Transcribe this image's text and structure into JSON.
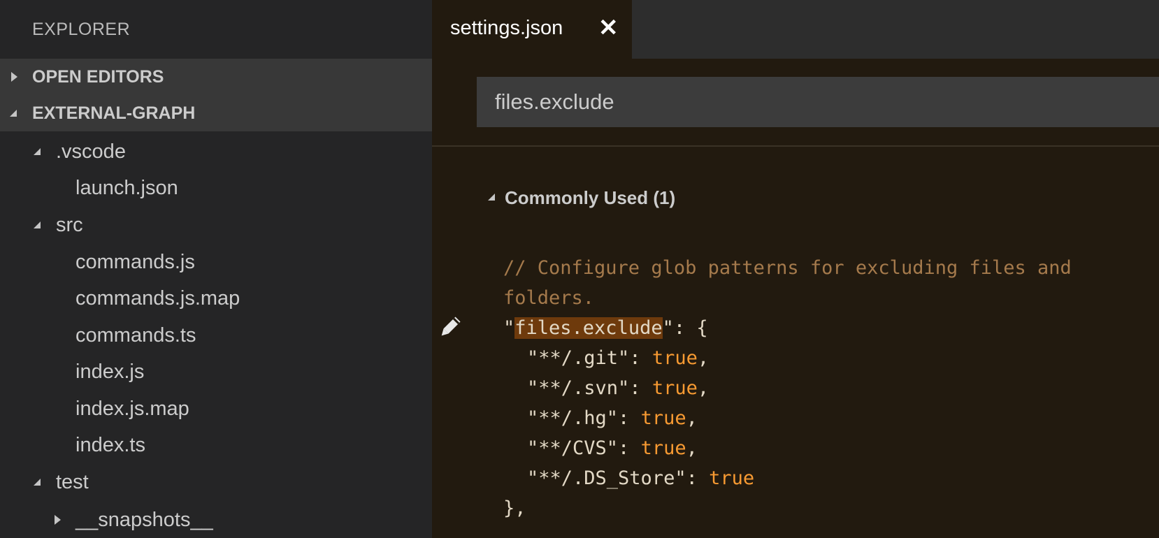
{
  "sidebar": {
    "title": "EXPLORER",
    "sections": [
      {
        "label": "OPEN EDITORS",
        "expanded": false
      },
      {
        "label": "EXTERNAL-GRAPH",
        "expanded": true
      }
    ],
    "tree": [
      {
        "name": ".vscode",
        "type": "folder",
        "expanded": true
      },
      {
        "name": "launch.json",
        "type": "file"
      },
      {
        "name": "src",
        "type": "folder",
        "expanded": true
      },
      {
        "name": "commands.js",
        "type": "file"
      },
      {
        "name": "commands.js.map",
        "type": "file"
      },
      {
        "name": "commands.ts",
        "type": "file"
      },
      {
        "name": "index.js",
        "type": "file"
      },
      {
        "name": "index.js.map",
        "type": "file"
      },
      {
        "name": "index.ts",
        "type": "file"
      },
      {
        "name": "test",
        "type": "folder",
        "expanded": true
      },
      {
        "name": "__snapshots__",
        "type": "folder",
        "expanded": false
      }
    ]
  },
  "editor": {
    "tab": {
      "label": "settings.json",
      "close": "✕"
    },
    "search": {
      "value": "files.exclude",
      "placeholder": ""
    },
    "group": {
      "label": "Commonly Used (1)"
    },
    "code": {
      "comment1": "// Configure glob patterns for excluding files and",
      "comment2": "folders.",
      "quote_open": "\"",
      "key": "files.exclude",
      "key_rest": "\": {",
      "entries": [
        {
          "key": "\"**/.git\"",
          "sep": ": ",
          "value": "true",
          "trail": ","
        },
        {
          "key": "\"**/.svn\"",
          "sep": ": ",
          "value": "true",
          "trail": ","
        },
        {
          "key": "\"**/.hg\"",
          "sep": ": ",
          "value": "true",
          "trail": ","
        },
        {
          "key": "\"**/CVS\"",
          "sep": ": ",
          "value": "true",
          "trail": ","
        },
        {
          "key": "\"**/.DS_Store\"",
          "sep": ": ",
          "value": "true",
          "trail": ""
        }
      ],
      "close": "},"
    }
  },
  "colors": {
    "editor_bg": "#221a0f",
    "sidebar_bg": "#252526",
    "highlight": "#6e3a0c",
    "keyword": "#f79a32",
    "comment": "#a57a4c"
  }
}
